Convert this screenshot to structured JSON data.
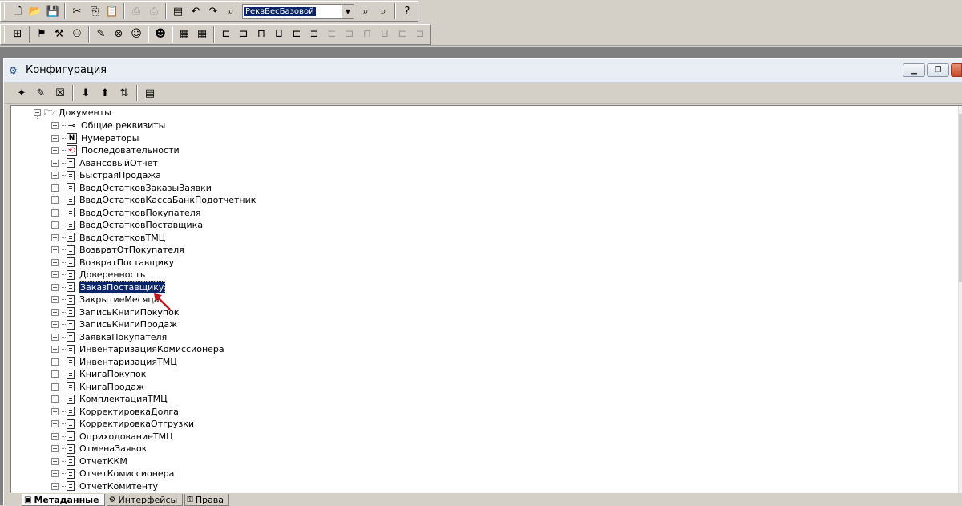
{
  "toolbar1": {
    "combo_value": "РеквВесБазовой"
  },
  "window": {
    "title": "Конфигурация"
  },
  "tree": {
    "root": "Документы",
    "items": [
      {
        "label": "Общие реквизиты",
        "icon": "link-icon",
        "selected": false
      },
      {
        "label": "Нумераторы",
        "icon": "numerator-icon",
        "selected": false
      },
      {
        "label": "Последовательности",
        "icon": "sequence-icon",
        "selected": false
      },
      {
        "label": "АвансовыйОтчет",
        "icon": "document-icon",
        "selected": false
      },
      {
        "label": "БыстраяПродажа",
        "icon": "document-icon",
        "selected": false
      },
      {
        "label": "ВводОстатковЗаказыЗаявки",
        "icon": "document-icon",
        "selected": false
      },
      {
        "label": "ВводОстатковКассаБанкПодотчетник",
        "icon": "document-icon",
        "selected": false
      },
      {
        "label": "ВводОстатковПокупателя",
        "icon": "document-icon",
        "selected": false
      },
      {
        "label": "ВводОстатковПоставщика",
        "icon": "document-icon",
        "selected": false
      },
      {
        "label": "ВводОстатковТМЦ",
        "icon": "document-icon",
        "selected": false
      },
      {
        "label": "ВозвратОтПокупателя",
        "icon": "document-icon",
        "selected": false
      },
      {
        "label": "ВозвратПоставщику",
        "icon": "document-icon",
        "selected": false
      },
      {
        "label": "Доверенность",
        "icon": "document-icon",
        "selected": false
      },
      {
        "label": "ЗаказПоставщику",
        "icon": "document-icon",
        "selected": true
      },
      {
        "label": "ЗакрытиеМесяца",
        "icon": "document-icon",
        "selected": false
      },
      {
        "label": "ЗаписьКнигиПокупок",
        "icon": "document-icon",
        "selected": false
      },
      {
        "label": "ЗаписьКнигиПродаж",
        "icon": "document-icon",
        "selected": false
      },
      {
        "label": "ЗаявкаПокупателя",
        "icon": "document-icon",
        "selected": false
      },
      {
        "label": "ИнвентаризацияКомиссионера",
        "icon": "document-icon",
        "selected": false
      },
      {
        "label": "ИнвентаризацияТМЦ",
        "icon": "document-icon",
        "selected": false
      },
      {
        "label": "КнигаПокупок",
        "icon": "document-icon",
        "selected": false
      },
      {
        "label": "КнигаПродаж",
        "icon": "document-icon",
        "selected": false
      },
      {
        "label": "КомплектацияТМЦ",
        "icon": "document-icon",
        "selected": false
      },
      {
        "label": "КорректировкаДолга",
        "icon": "document-icon",
        "selected": false
      },
      {
        "label": "КорректировкаОтгрузки",
        "icon": "document-icon",
        "selected": false
      },
      {
        "label": "ОприходованиеТМЦ",
        "icon": "document-icon",
        "selected": false
      },
      {
        "label": "ОтменаЗаявок",
        "icon": "document-icon",
        "selected": false
      },
      {
        "label": "ОтчетККМ",
        "icon": "document-icon",
        "selected": false
      },
      {
        "label": "ОтчетКомиссионера",
        "icon": "document-icon",
        "selected": false
      },
      {
        "label": "ОтчетКомитенту",
        "icon": "document-icon",
        "selected": false
      }
    ]
  },
  "tabs": [
    {
      "label": "Метаданные",
      "active": true
    },
    {
      "label": "Интерфейсы",
      "active": false
    },
    {
      "label": "Права",
      "active": false
    }
  ],
  "colors": {
    "selection": "#0a246a",
    "pointer_arrow": "#c0141e"
  }
}
